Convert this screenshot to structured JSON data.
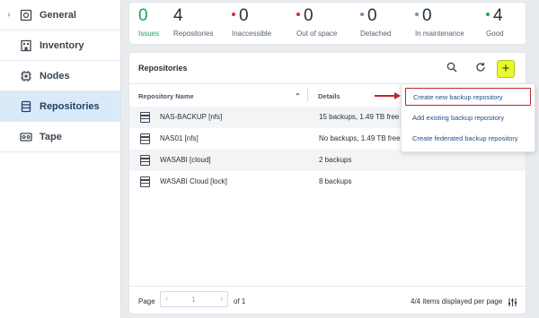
{
  "sidebar": {
    "items": [
      {
        "label": "General",
        "icon": "dashboard-icon",
        "collapsed_chevron": "›"
      },
      {
        "label": "Inventory",
        "icon": "building-icon"
      },
      {
        "label": "Nodes",
        "icon": "chip-icon"
      },
      {
        "label": "Repositories",
        "icon": "database-icon",
        "active": true
      },
      {
        "label": "Tape",
        "icon": "tape-icon"
      }
    ]
  },
  "stats": [
    {
      "value": "0",
      "label": "Issues",
      "color": "#1aa55a",
      "label_color": "#1aa55a"
    },
    {
      "value": "4",
      "label": "Repositories"
    },
    {
      "value": "0",
      "label": "Inaccessible",
      "dot": "#d0312d"
    },
    {
      "value": "0",
      "label": "Out of space",
      "dot": "#d0312d"
    },
    {
      "value": "0",
      "label": "Detached",
      "dot": "#7a8fa3"
    },
    {
      "value": "0",
      "label": "In maintenance",
      "dot": "#7a8fa3"
    },
    {
      "value": "4",
      "label": "Good",
      "dot": "#1aa55a"
    }
  ],
  "panel": {
    "title": "Repositories",
    "columns": {
      "name": "Repository Name",
      "details": "Details"
    },
    "rows": [
      {
        "name": "NAS-BACKUP [nfs]",
        "details": "15 backups, 1.49 TB free"
      },
      {
        "name": "NAS01 [nfs]",
        "details": "No backups, 1.49 TB free"
      },
      {
        "name": "WASABI [cloud]",
        "details": "2 backups"
      },
      {
        "name": "WASABI Cloud [lock]",
        "details": "8 backups"
      }
    ],
    "add_label": "+"
  },
  "menu": {
    "items": [
      "Create new backup repository",
      "Add existing backup repository",
      "Create federated backup repository"
    ]
  },
  "footer": {
    "page_label": "Page",
    "page_value": "1",
    "of_label": "of 1",
    "prev": "‹",
    "next": "›",
    "items_info": "4/4 items displayed per page"
  },
  "colors": {
    "accent_add": "#e8f82a",
    "highlight": "#c0272d",
    "active_nav": "#dbeaf8"
  }
}
